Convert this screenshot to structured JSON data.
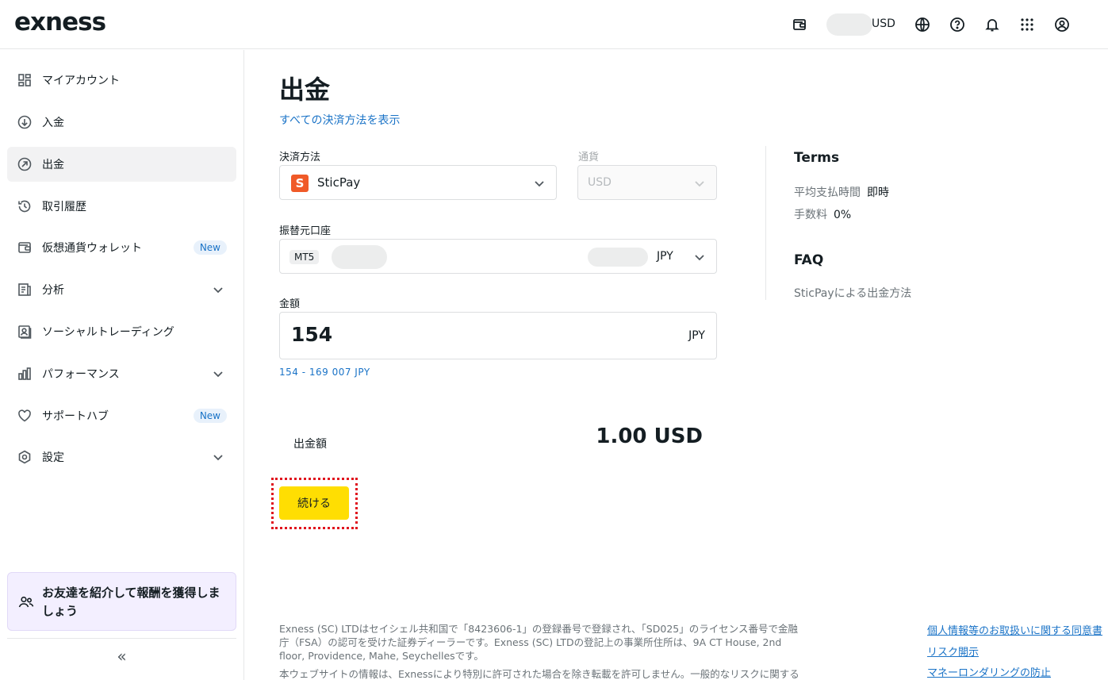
{
  "header": {
    "logo": "exness",
    "balance_currency": "USD",
    "icons": [
      "wallet-icon",
      "globe-icon",
      "help-icon",
      "bell-icon",
      "apps-icon",
      "user-icon"
    ]
  },
  "sidebar": {
    "items": [
      {
        "label": "マイアカウント",
        "icon": "dashboard-icon"
      },
      {
        "label": "入金",
        "icon": "deposit-icon"
      },
      {
        "label": "出金",
        "icon": "withdraw-icon",
        "active": true
      },
      {
        "label": "取引履歴",
        "icon": "history-icon"
      },
      {
        "label": "仮想通貨ウォレット",
        "icon": "wallet-icon",
        "badge": "New"
      },
      {
        "label": "分析",
        "icon": "analytics-icon",
        "expandable": true
      },
      {
        "label": "ソーシャルトレーディング",
        "icon": "social-icon"
      },
      {
        "label": "パフォーマンス",
        "icon": "performance-icon",
        "expandable": true
      },
      {
        "label": "サポートハブ",
        "icon": "heart-icon",
        "badge": "New"
      },
      {
        "label": "設定",
        "icon": "settings-icon",
        "expandable": true
      }
    ],
    "promo_text": "お友達を紹介して報酬を獲得しましょう",
    "collapse_glyph": "«"
  },
  "main": {
    "title": "出金",
    "all_methods_link": "すべての決済方法を表示",
    "payment_method": {
      "label": "決済方法",
      "value": "SticPay",
      "logo_letter": "S"
    },
    "currency": {
      "label": "通貨",
      "value": "USD"
    },
    "source_account": {
      "label": "振替元口座",
      "type": "MT5",
      "currency": "JPY"
    },
    "amount": {
      "label": "金額",
      "value": "154",
      "currency": "JPY",
      "range": "154 - 169 007 JPY"
    },
    "withdrawal": {
      "label": "出金額",
      "value": "1.00 USD"
    },
    "continue_button": "続ける"
  },
  "terms": {
    "heading": "Terms",
    "rows": [
      {
        "key": "平均支払時間",
        "value": "即時"
      },
      {
        "key": "手数料",
        "value": "0%"
      }
    ]
  },
  "faq": {
    "heading": "FAQ",
    "link": "SticPayによる出金方法"
  },
  "footer": {
    "text1": "Exness (SC) LTDはセイシェル共和国で「8423606-1」の登録番号で登録され、「SD025」のライセンス番号で金融庁（FSA）の認可を受けた証券ディーラーです。Exness (SC) LTDの登記上の事業所住所は、9A CT House, 2nd floor, Providence, Mahe, Seychellesです。",
    "text2": "本ウェブサイトの情報は、Exnessにより特別に許可された場合を除き転載を許可しません。一般的なリスクに関する警告：",
    "links": [
      "個人情報等のお取扱いに関する同意書",
      "リスク開示",
      "マネーロンダリングの防止"
    ]
  }
}
